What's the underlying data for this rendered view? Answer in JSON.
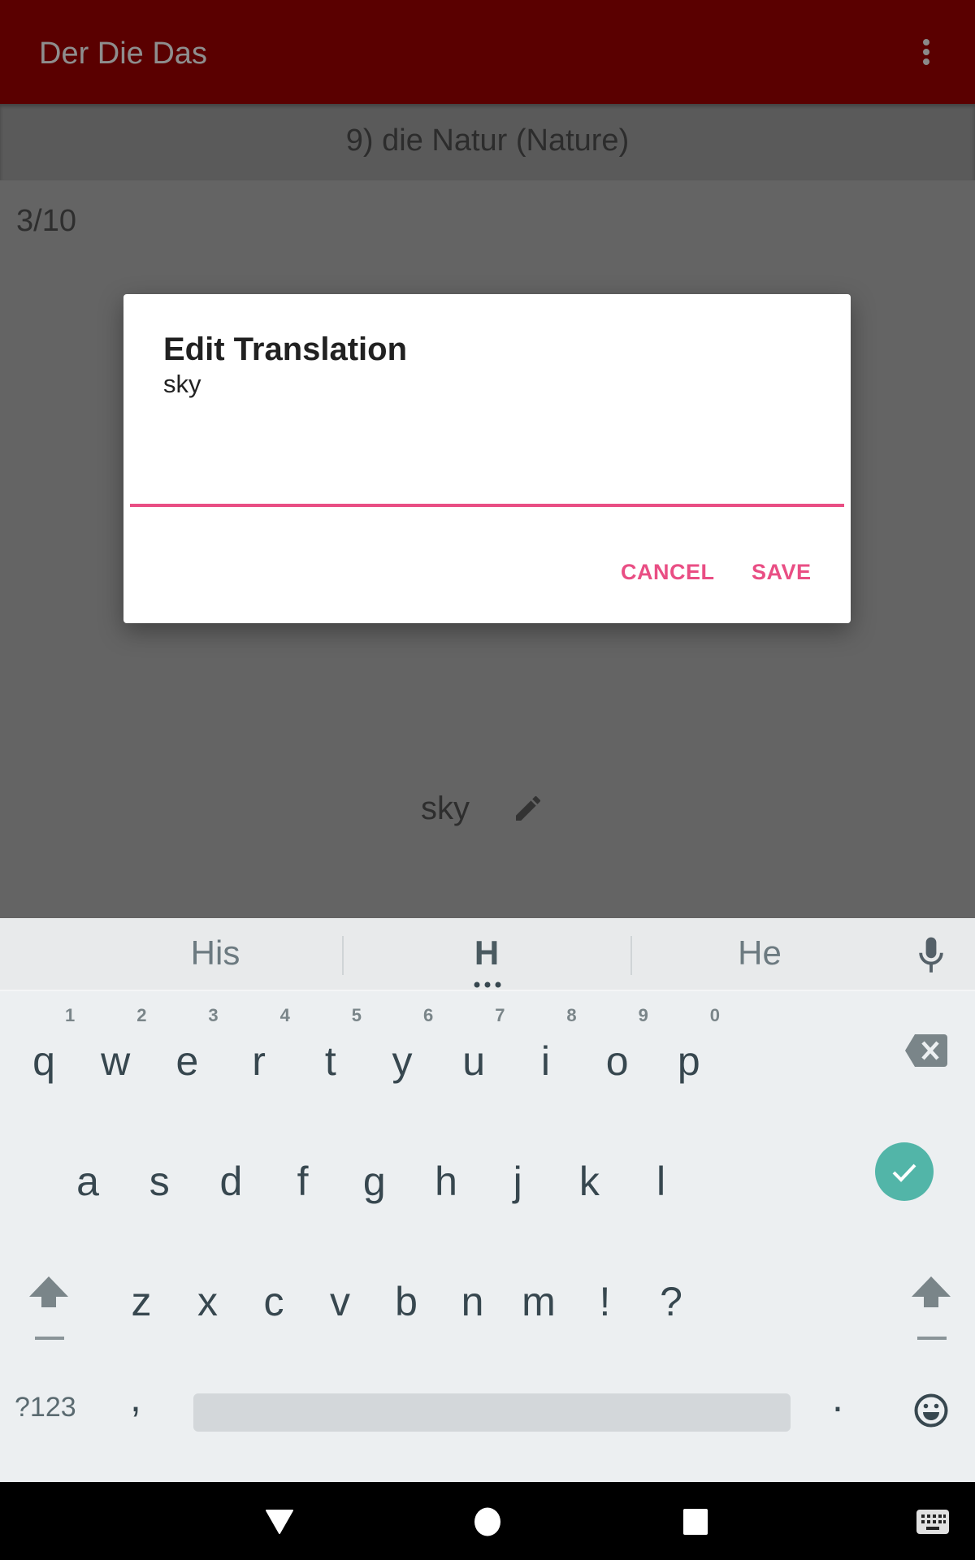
{
  "app": {
    "title": "Der Die Das",
    "overflow_menu_icon": "more-vert-icon",
    "topic": "9) die Natur (Nature)",
    "progress": "3/10",
    "word_translation": "sky",
    "edit_icon": "pencil-icon"
  },
  "dialog": {
    "title": "Edit Translation",
    "message": "sky",
    "input_value": "",
    "input_placeholder": "",
    "cancel_label": "CANCEL",
    "save_label": "SAVE",
    "accent_color": "#e94e84"
  },
  "keyboard": {
    "suggestions": [
      "His",
      "H",
      "He"
    ],
    "mic_icon": "mic-icon",
    "row1": [
      {
        "key": "q",
        "hint": "1"
      },
      {
        "key": "w",
        "hint": "2"
      },
      {
        "key": "e",
        "hint": "3"
      },
      {
        "key": "r",
        "hint": "4"
      },
      {
        "key": "t",
        "hint": "5"
      },
      {
        "key": "y",
        "hint": "6"
      },
      {
        "key": "u",
        "hint": "7"
      },
      {
        "key": "i",
        "hint": "8"
      },
      {
        "key": "o",
        "hint": "9"
      },
      {
        "key": "p",
        "hint": "0"
      }
    ],
    "row2": [
      "a",
      "s",
      "d",
      "f",
      "g",
      "h",
      "j",
      "k",
      "l"
    ],
    "row3": [
      "z",
      "x",
      "c",
      "v",
      "b",
      "n",
      "m",
      "!",
      "?"
    ],
    "symbols_label": "?123",
    "comma": ",",
    "period": ".",
    "enter_color": "#52b5a8"
  },
  "navbar": {
    "icons": [
      "back-icon",
      "home-icon",
      "recents-icon",
      "keyboard-switch-icon"
    ]
  }
}
